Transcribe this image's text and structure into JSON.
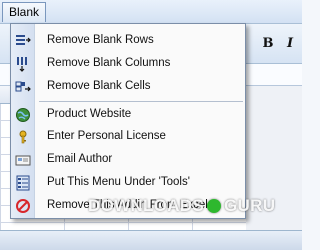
{
  "menubar": {
    "blank_label": "Blank"
  },
  "toolbar": {
    "bold": "B",
    "italic": "I"
  },
  "menu": {
    "items": [
      {
        "label": "Remove Blank Rows",
        "icon": "rows-icon"
      },
      {
        "label": "Remove Blank Columns",
        "icon": "columns-icon"
      },
      {
        "label": "Remove Blank Cells",
        "icon": "cells-icon"
      },
      {
        "label": "Product Website",
        "icon": "globe-icon"
      },
      {
        "label": "Enter Personal License",
        "icon": "key-icon"
      },
      {
        "label": "Email Author",
        "icon": "envelope-icon"
      },
      {
        "label": "Put This Menu Under 'Tools'",
        "icon": "toolbar-icon"
      },
      {
        "label": "Remove This Addin From Excel",
        "icon": "prohibited-icon"
      }
    ]
  },
  "watermark": {
    "left": "DOWNLOADS",
    "right": "GURU"
  }
}
